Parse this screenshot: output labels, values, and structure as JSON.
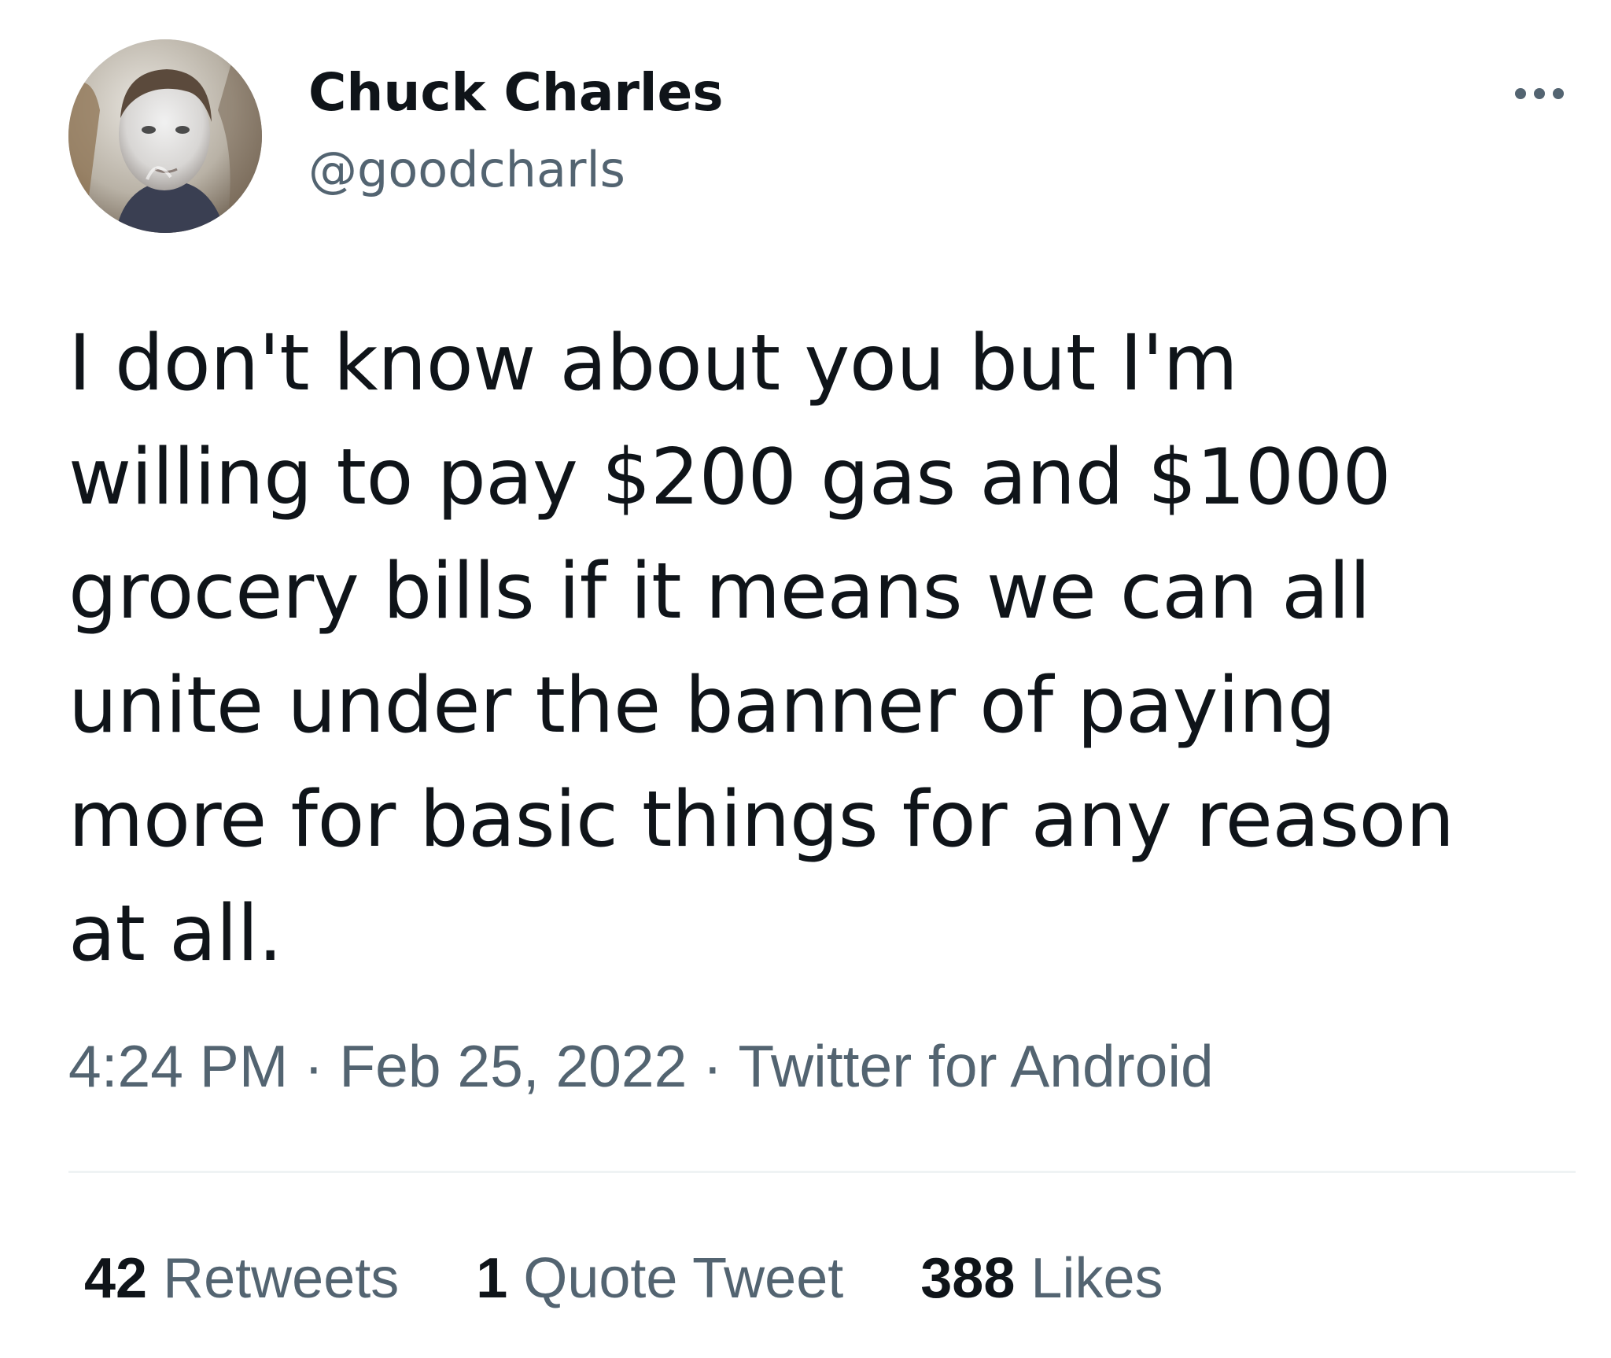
{
  "tweet": {
    "author": {
      "display_name": "Chuck Charles",
      "handle": "@goodcharls"
    },
    "text_lines": [
      "I don't know about you but I'm",
      "willing to pay $200 gas and $1000",
      "grocery bills if it means we can all",
      "unite under the banner of paying",
      "more for basic things for any reason",
      "at all."
    ],
    "time": "4:24 PM",
    "separator": "·",
    "date": "Feb 25, 2022",
    "source": "Twitter for Android",
    "stats": {
      "retweets_count": "42",
      "retweets_label": "Retweets",
      "quotes_count": "1",
      "quotes_label": "Quote Tweet",
      "likes_count": "388",
      "likes_label": "Likes"
    }
  },
  "icons": {
    "more": "more-horizontal-icon",
    "avatar": "user-avatar"
  },
  "colors": {
    "primary_text": "#0f1419",
    "secondary_text": "#536471",
    "divider": "#eff3f4",
    "background": "#ffffff"
  }
}
